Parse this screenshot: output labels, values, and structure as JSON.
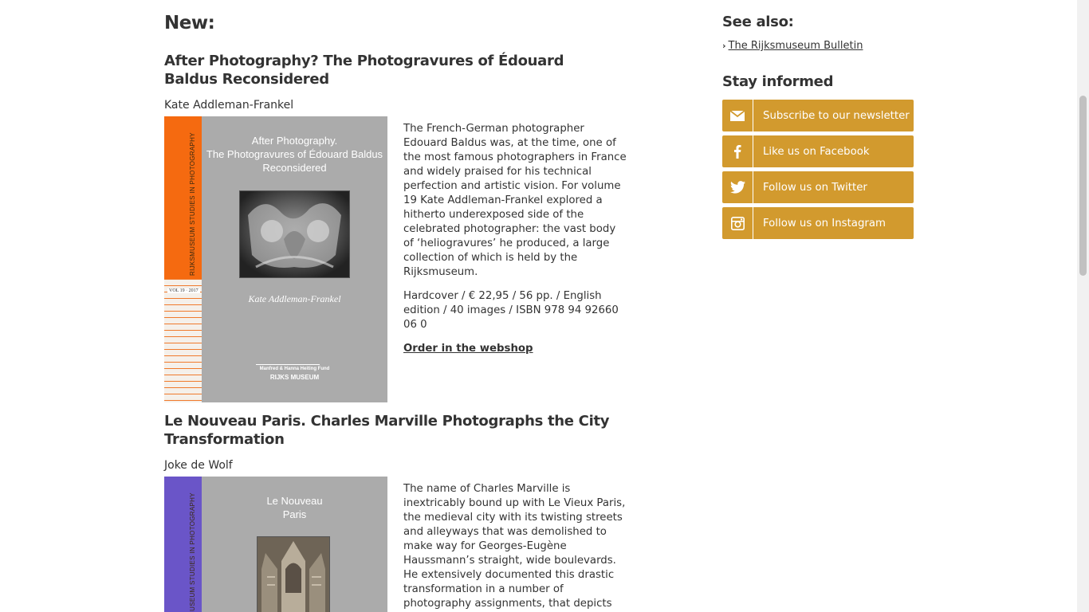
{
  "main": {
    "heading": "New:",
    "books": [
      {
        "title": "After Photography? The Photogravures of Édouard Baldus Reconsidered",
        "author": "Kate Addleman-Frankel",
        "description": "The French-German photographer Edouard Baldus was, at the time, one of the most famous photographers in France and widely praised for his technical perfection and artistic vision. For volume 19 Kate Addleman-Frankel explored a hitherto underexposed side of the celebrated photographer: the vast body of ‘heliogravures’ he produced, a large collection of which is held by the Rijksmuseum.",
        "specs": "Hardcover / € 22,95 / 56 pp. / English edition / 40 images / ISBN 978 94 92660 06 0",
        "order_label": "Order in the webshop",
        "cover": {
          "spine_color": "#f56a10",
          "spine_text": "RIJKSMUSEUM STUDIES IN PHOTOGRAPHY",
          "volume": "VOL 19 · 2017",
          "title": "After Photography.\nThe Photogravures of Édouard Baldus\nReconsidered",
          "author": "Kate Addleman-Frankel",
          "fund": "Manfred & Hanna Heiting Fund",
          "museum": "RIJKS MUSEUM"
        }
      },
      {
        "title": "Le Nouveau Paris. Charles Marville Photographs the City Transformation",
        "author": "Joke de Wolf",
        "description": "The name of Charles Marville is inextricably bound up with Le Vieux Paris, the medieval city with its twisting streets and alleyways that was demolished to make way for Georges-Eugène Haussmann’s straight, wide boulevards. He extensively documented this drastic transformation in a number of photography assignments, that depicts not just the old city but the New Paris, Paris",
        "cover": {
          "spine_color": "#6a55c8",
          "spine_text": "RIJKSMUSEUM STUDIES IN PHOTOGRAPHY",
          "title": "Le Nouveau\nParis"
        }
      }
    ]
  },
  "sidebar": {
    "see_also_heading": "See also:",
    "see_also_links": [
      "The Rijksmuseum Bulletin"
    ],
    "stay_informed_heading": "Stay informed",
    "social": [
      {
        "icon": "mail-icon",
        "label": "Subscribe to our newsletter"
      },
      {
        "icon": "facebook-icon",
        "label": "Like us on Facebook"
      },
      {
        "icon": "twitter-icon",
        "label": "Follow us on Twitter"
      },
      {
        "icon": "instagram-icon",
        "label": "Follow us on Instagram"
      }
    ]
  },
  "colors": {
    "accent": "#d29a2e",
    "text": "#333333"
  }
}
